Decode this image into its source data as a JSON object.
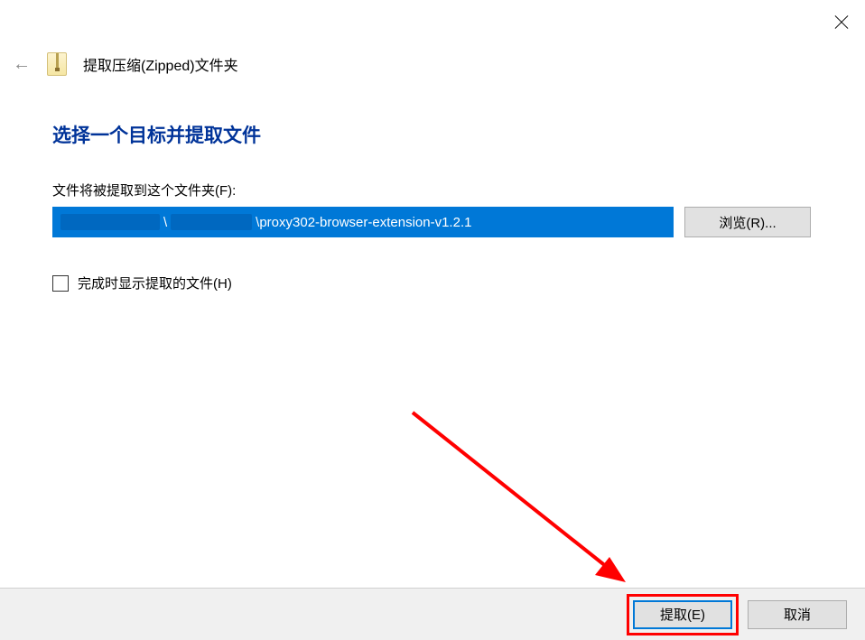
{
  "titlebar": {
    "close": "✕"
  },
  "header": {
    "back": "←",
    "title": "提取压缩(Zipped)文件夹"
  },
  "main": {
    "heading": "选择一个目标并提取文件",
    "path_label": "文件将被提取到这个文件夹(F):",
    "path_value_visible": "\\proxy302-browser-extension-v1.2.1",
    "browse_label": "浏览(R)...",
    "checkbox_label": "完成时显示提取的文件(H)",
    "checkbox_checked": false
  },
  "footer": {
    "extract_label": "提取(E)",
    "cancel_label": "取消"
  },
  "annotation": {
    "arrow_color": "#f00"
  }
}
